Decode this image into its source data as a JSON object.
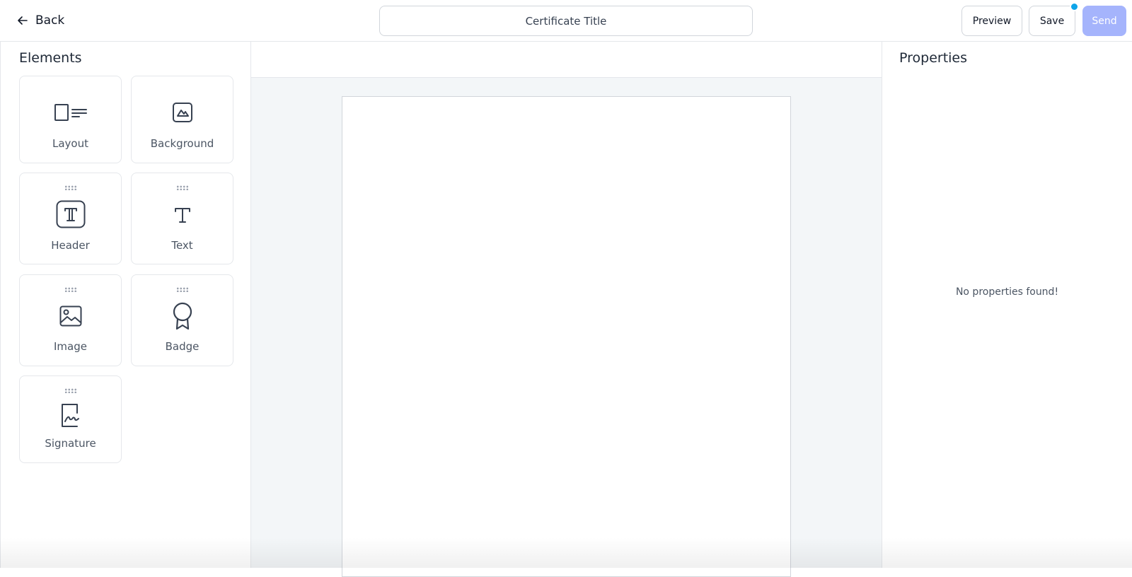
{
  "header": {
    "back_label": "Back",
    "title_value": "Certificate Title",
    "preview_label": "Preview",
    "save_label": "Save",
    "send_label": "Send",
    "send_color": "#a5b4fc",
    "unsaved_dot_color": "#0ea5e9"
  },
  "elements_panel": {
    "title": "Elements",
    "items": [
      {
        "label": "Layout",
        "icon": "layout-icon"
      },
      {
        "label": "Background",
        "icon": "background-image-icon"
      },
      {
        "label": "Header",
        "icon": "header-text-icon"
      },
      {
        "label": "Text",
        "icon": "text-icon"
      },
      {
        "label": "Image",
        "icon": "image-icon"
      },
      {
        "label": "Badge",
        "icon": "badge-ribbon-icon"
      },
      {
        "label": "Signature",
        "icon": "signature-icon"
      }
    ]
  },
  "properties_panel": {
    "title": "Properties",
    "empty_message": "No properties found!"
  }
}
